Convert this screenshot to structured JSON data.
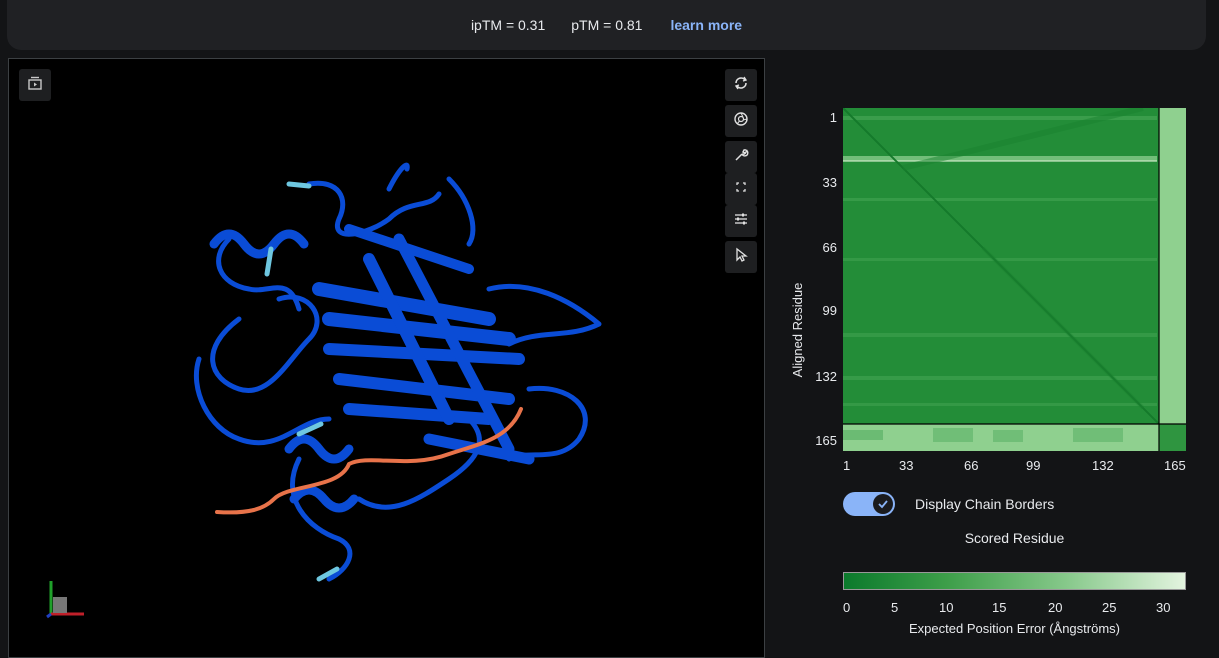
{
  "header": {
    "iptm": "ipTM = 0.31",
    "ptm": "pTM = 0.81",
    "learn_more": "learn more"
  },
  "viewer": {
    "buttons": [
      "animation-icon",
      "reset-icon",
      "screenshot-icon",
      "wrench-icon",
      "fullscreen-icon",
      "sliders-icon",
      "cursor-icon"
    ],
    "chain_colors": {
      "chain_a": "#0a4cd6",
      "chain_b": "#e8734a",
      "low_confidence": "#6ec7e0"
    }
  },
  "pae": {
    "y_axis_label": "Aligned Residue",
    "x_axis_label": "Scored Residue",
    "y_ticks": [
      "1",
      "33",
      "66",
      "99",
      "132",
      "165"
    ],
    "x_ticks": [
      "1",
      "33",
      "66",
      "99",
      "132",
      "165"
    ],
    "toggle_label": "Display Chain Borders",
    "toggle_on": true,
    "colorbar_ticks": [
      "0",
      "5",
      "10",
      "15",
      "20",
      "25",
      "30"
    ],
    "colorbar_title": "Expected Position Error (Ångströms)",
    "colors": {
      "low": "#0b7a2c",
      "high": "#e3f4df"
    }
  }
}
